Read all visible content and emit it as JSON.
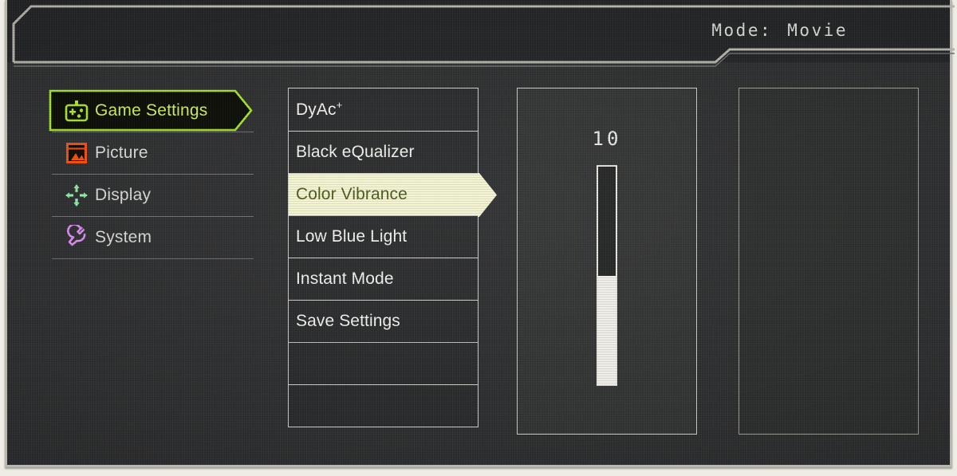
{
  "header": {
    "mode_label": "Mode",
    "mode_separator": ":",
    "mode_value": "Movie"
  },
  "sidebar": {
    "items": [
      {
        "label": "Game Settings",
        "icon": "gamepad-icon",
        "selected": true,
        "color": "#a5e32c"
      },
      {
        "label": "Picture",
        "icon": "image-icon",
        "selected": false,
        "color": "#f15a22"
      },
      {
        "label": "Display",
        "icon": "arrows-in-icon",
        "selected": false,
        "color": "#8de8a6"
      },
      {
        "label": "System",
        "icon": "wrench-icon",
        "selected": false,
        "color": "#d88ae8"
      }
    ]
  },
  "menu": {
    "items": [
      {
        "label": "DyAc",
        "superscript": "+",
        "highlighted": false
      },
      {
        "label": "Black eQualizer",
        "superscript": "",
        "highlighted": false
      },
      {
        "label": "Color Vibrance",
        "superscript": "",
        "highlighted": true
      },
      {
        "label": "Low Blue Light",
        "superscript": "",
        "highlighted": false
      },
      {
        "label": "Instant Mode",
        "superscript": "",
        "highlighted": false
      },
      {
        "label": "Save Settings",
        "superscript": "",
        "highlighted": false
      },
      {
        "label": "",
        "superscript": "",
        "highlighted": false
      },
      {
        "label": "",
        "superscript": "",
        "highlighted": false
      }
    ]
  },
  "slider": {
    "value": "10",
    "fill_percent": 50,
    "min": 0,
    "max": 20
  },
  "colors": {
    "highlight_bg": "#f4f4d2",
    "highlight_text": "#4b5a18",
    "selected_outline": "#a5e32c",
    "panel_border": "#c9c9c6",
    "background": "#2e2f30"
  }
}
